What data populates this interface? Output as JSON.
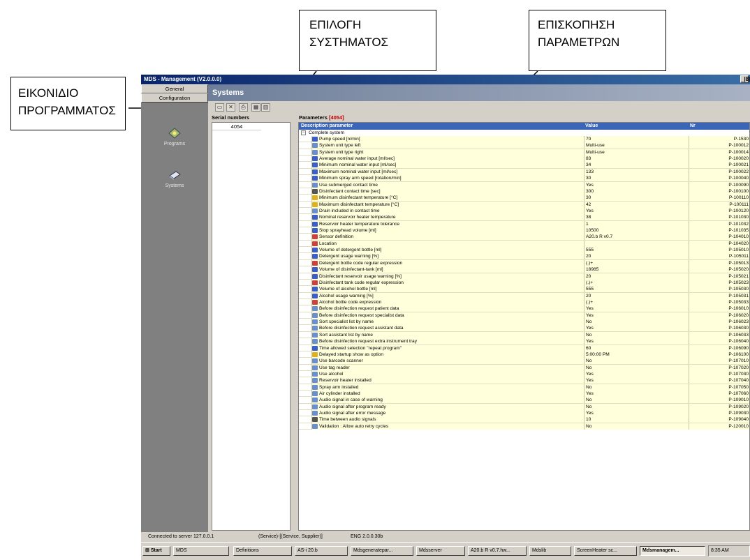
{
  "callouts": {
    "system_select": [
      "ΕΠΙΛΟΓΗ",
      "ΣΥΣΤΗΜΑΤΟΣ"
    ],
    "params_overview": [
      "ΕΠΙΣΚΟΠΗΣΗ",
      "ΠΑΡΑΜΕΤΡΩΝ"
    ],
    "program_icon": [
      "ΕΙΚΟΝΙΔΙΟ",
      "ΠΡΟΓΡΑΜΜΑΤΟΣ"
    ]
  },
  "window": {
    "title": "MDS - Management  (V2.0.0.0)",
    "controls": "_|8|"
  },
  "left_nav": {
    "tabs": [
      "General",
      "Configuration"
    ],
    "items": [
      {
        "label": "Programs",
        "icon": "programs-icon"
      },
      {
        "label": "Systems",
        "icon": "systems-icon"
      }
    ]
  },
  "header": {
    "title": "Systems"
  },
  "serial": {
    "title": "Serial numbers",
    "items": [
      "4054"
    ]
  },
  "params": {
    "title": "Parameters",
    "serial": "[4054]",
    "columns": [
      "Description parameter",
      "Value",
      "Nr"
    ],
    "group": "Complete system",
    "rows": [
      {
        "d": "Pump speed [n/min]",
        "v": "70",
        "n": "P-1530",
        "i": "numeric"
      },
      {
        "d": "System unit type left",
        "v": "Multi-use",
        "n": "P-100012",
        "i": "edit"
      },
      {
        "d": "System unit type right",
        "v": "Multi-use",
        "n": "P-100014",
        "i": "edit"
      },
      {
        "d": "Average nominal water input [ml/sec]",
        "v": "83",
        "n": "P-100020",
        "i": "numeric"
      },
      {
        "d": "Minimum nominal water input  [ml/sec]",
        "v": "34",
        "n": "P-100021",
        "i": "numeric"
      },
      {
        "d": "Maximum nominal water input [ml/sec]",
        "v": "133",
        "n": "P-100022",
        "i": "numeric"
      },
      {
        "d": "Minimum spray arm speed [rotation/min]",
        "v": "30",
        "n": "P-100040",
        "i": "numeric"
      },
      {
        "d": "Use submerged contact time",
        "v": "Yes",
        "n": "P-100090",
        "i": "check"
      },
      {
        "d": "Disinfectant contact time [sec]",
        "v": "300",
        "n": "P-100100",
        "i": "clock"
      },
      {
        "d": "Minimum disinfectant temperature [°C]",
        "v": "30",
        "n": "P-100110",
        "i": "temp"
      },
      {
        "d": "Maximum disinfectant temperature [°C]",
        "v": "42",
        "n": "P-100111",
        "i": "temp"
      },
      {
        "d": "Drain included in contact time",
        "v": "Yes",
        "n": "P-100120",
        "i": "check"
      },
      {
        "d": "Nominal reservoir heater temperature",
        "v": "38",
        "n": "P-101030",
        "i": "numeric"
      },
      {
        "d": "Reservoir heater temperature tolerance",
        "v": "1",
        "n": "P-101032",
        "i": "numeric"
      },
      {
        "d": "Stop sprayhead volume [ml]",
        "v": "10500",
        "n": "P-101035",
        "i": "numeric"
      },
      {
        "d": "Sensor definition",
        "v": "A20.b R v0.7",
        "n": "P-104010",
        "i": "text"
      },
      {
        "d": "Location",
        "v": "",
        "n": "P-104020",
        "i": "text"
      },
      {
        "d": "Volume of detergent bottle [ml]",
        "v": "555",
        "n": "P-105010",
        "i": "numeric"
      },
      {
        "d": "Detergent usage warning [%]",
        "v": "20",
        "n": "P-105011",
        "i": "numeric"
      },
      {
        "d": "Detergent bottle code regular expression",
        "v": "(.)+",
        "n": "P-105013",
        "i": "text"
      },
      {
        "d": "Volume of disinfectant-tank [ml]",
        "v": "18985",
        "n": "P-105020",
        "i": "numeric"
      },
      {
        "d": "Disinfectant reservoir usage warning [%]",
        "v": "20",
        "n": "P-105021",
        "i": "numeric"
      },
      {
        "d": "Disinfectant tank code regular expression",
        "v": "(.)+",
        "n": "P-105023",
        "i": "text"
      },
      {
        "d": "Volume of alcohol bottle [ml]",
        "v": "555",
        "n": "P-105030",
        "i": "numeric"
      },
      {
        "d": "Alcohol usage warning [%]",
        "v": "20",
        "n": "P-105031",
        "i": "numeric"
      },
      {
        "d": "Alcohol bottle code expression",
        "v": "(.)+",
        "n": "P-105033",
        "i": "text"
      },
      {
        "d": "Before disinfection request patient data",
        "v": "Yes",
        "n": "P-106010",
        "i": "check"
      },
      {
        "d": "Before disinfection request specialist data",
        "v": "Yes",
        "n": "P-106020",
        "i": "check"
      },
      {
        "d": "Sort specialist list by name",
        "v": "No",
        "n": "P-106023",
        "i": "check"
      },
      {
        "d": "Before disinfection request assistant data",
        "v": "Yes",
        "n": "P-106030",
        "i": "check"
      },
      {
        "d": "Sort assistant list by name",
        "v": "No",
        "n": "P-106033",
        "i": "check"
      },
      {
        "d": "Before disinfection request extra instrument tray",
        "v": "Yes",
        "n": "P-106040",
        "i": "check"
      },
      {
        "d": "Time allowed selection \"repeat program\"",
        "v": "60",
        "n": "P-106090",
        "i": "numeric"
      },
      {
        "d": "Delayed startup show as option",
        "v": "5:00:00 PM",
        "n": "P-106100",
        "i": "time"
      },
      {
        "d": "Use barcode scanner",
        "v": "No",
        "n": "P-107010",
        "i": "check"
      },
      {
        "d": "Use tag reader",
        "v": "No",
        "n": "P-107020",
        "i": "check"
      },
      {
        "d": "Use alcohol",
        "v": "Yes",
        "n": "P-107030",
        "i": "check"
      },
      {
        "d": "Reservoir heater installed",
        "v": "Yes",
        "n": "P-107040",
        "i": "check"
      },
      {
        "d": "Spray arm installed",
        "v": "No",
        "n": "P-107050",
        "i": "check"
      },
      {
        "d": "Air cylinder installed",
        "v": "Yes",
        "n": "P-107060",
        "i": "check"
      },
      {
        "d": "Audio signal in case of warning",
        "v": "No",
        "n": "P-109010",
        "i": "check"
      },
      {
        "d": "Audio signal after program ready",
        "v": "No",
        "n": "P-109020",
        "i": "check"
      },
      {
        "d": "Audio signal after error message",
        "v": "Yes",
        "n": "P-109030",
        "i": "check"
      },
      {
        "d": "Time between audio signals",
        "v": "10",
        "n": "P-109040",
        "i": "clock"
      },
      {
        "d": "Validation : Allow auto retry cycles",
        "v": "No",
        "n": "P-120010",
        "i": "check"
      }
    ]
  },
  "status": [
    "Connected to server 127.0.0.1",
    "(Service)-[(Service, Supplier)]",
    "ENG 2.0.0.30b"
  ],
  "taskbar": {
    "start": "Start",
    "tasks": [
      "MDS",
      "Definitions",
      "AS-i 20.b",
      "Mdsgeneratepar...",
      "Mdsserver",
      "A20.b R v0.7.hw...",
      "Mdslib",
      "ScreenHeater sc...",
      "Mdsmanagem..."
    ],
    "clock": "8:35 AM"
  },
  "colors": {
    "accent": "#3b66b8",
    "grid_cell": "#ffffdc",
    "serial_red": "#c00000"
  }
}
